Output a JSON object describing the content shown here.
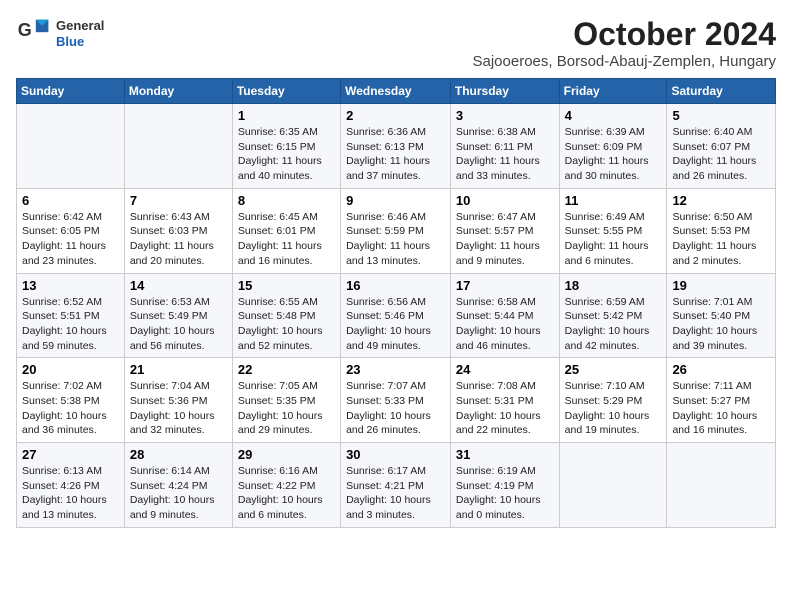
{
  "header": {
    "logo_line1": "General",
    "logo_line2": "Blue",
    "month": "October 2024",
    "location": "Sajooeroes, Borsod-Abauj-Zemplen, Hungary"
  },
  "weekdays": [
    "Sunday",
    "Monday",
    "Tuesday",
    "Wednesday",
    "Thursday",
    "Friday",
    "Saturday"
  ],
  "weeks": [
    [
      {
        "day": "",
        "detail": ""
      },
      {
        "day": "",
        "detail": ""
      },
      {
        "day": "1",
        "detail": "Sunrise: 6:35 AM\nSunset: 6:15 PM\nDaylight: 11 hours and 40 minutes."
      },
      {
        "day": "2",
        "detail": "Sunrise: 6:36 AM\nSunset: 6:13 PM\nDaylight: 11 hours and 37 minutes."
      },
      {
        "day": "3",
        "detail": "Sunrise: 6:38 AM\nSunset: 6:11 PM\nDaylight: 11 hours and 33 minutes."
      },
      {
        "day": "4",
        "detail": "Sunrise: 6:39 AM\nSunset: 6:09 PM\nDaylight: 11 hours and 30 minutes."
      },
      {
        "day": "5",
        "detail": "Sunrise: 6:40 AM\nSunset: 6:07 PM\nDaylight: 11 hours and 26 minutes."
      }
    ],
    [
      {
        "day": "6",
        "detail": "Sunrise: 6:42 AM\nSunset: 6:05 PM\nDaylight: 11 hours and 23 minutes."
      },
      {
        "day": "7",
        "detail": "Sunrise: 6:43 AM\nSunset: 6:03 PM\nDaylight: 11 hours and 20 minutes."
      },
      {
        "day": "8",
        "detail": "Sunrise: 6:45 AM\nSunset: 6:01 PM\nDaylight: 11 hours and 16 minutes."
      },
      {
        "day": "9",
        "detail": "Sunrise: 6:46 AM\nSunset: 5:59 PM\nDaylight: 11 hours and 13 minutes."
      },
      {
        "day": "10",
        "detail": "Sunrise: 6:47 AM\nSunset: 5:57 PM\nDaylight: 11 hours and 9 minutes."
      },
      {
        "day": "11",
        "detail": "Sunrise: 6:49 AM\nSunset: 5:55 PM\nDaylight: 11 hours and 6 minutes."
      },
      {
        "day": "12",
        "detail": "Sunrise: 6:50 AM\nSunset: 5:53 PM\nDaylight: 11 hours and 2 minutes."
      }
    ],
    [
      {
        "day": "13",
        "detail": "Sunrise: 6:52 AM\nSunset: 5:51 PM\nDaylight: 10 hours and 59 minutes."
      },
      {
        "day": "14",
        "detail": "Sunrise: 6:53 AM\nSunset: 5:49 PM\nDaylight: 10 hours and 56 minutes."
      },
      {
        "day": "15",
        "detail": "Sunrise: 6:55 AM\nSunset: 5:48 PM\nDaylight: 10 hours and 52 minutes."
      },
      {
        "day": "16",
        "detail": "Sunrise: 6:56 AM\nSunset: 5:46 PM\nDaylight: 10 hours and 49 minutes."
      },
      {
        "day": "17",
        "detail": "Sunrise: 6:58 AM\nSunset: 5:44 PM\nDaylight: 10 hours and 46 minutes."
      },
      {
        "day": "18",
        "detail": "Sunrise: 6:59 AM\nSunset: 5:42 PM\nDaylight: 10 hours and 42 minutes."
      },
      {
        "day": "19",
        "detail": "Sunrise: 7:01 AM\nSunset: 5:40 PM\nDaylight: 10 hours and 39 minutes."
      }
    ],
    [
      {
        "day": "20",
        "detail": "Sunrise: 7:02 AM\nSunset: 5:38 PM\nDaylight: 10 hours and 36 minutes."
      },
      {
        "day": "21",
        "detail": "Sunrise: 7:04 AM\nSunset: 5:36 PM\nDaylight: 10 hours and 32 minutes."
      },
      {
        "day": "22",
        "detail": "Sunrise: 7:05 AM\nSunset: 5:35 PM\nDaylight: 10 hours and 29 minutes."
      },
      {
        "day": "23",
        "detail": "Sunrise: 7:07 AM\nSunset: 5:33 PM\nDaylight: 10 hours and 26 minutes."
      },
      {
        "day": "24",
        "detail": "Sunrise: 7:08 AM\nSunset: 5:31 PM\nDaylight: 10 hours and 22 minutes."
      },
      {
        "day": "25",
        "detail": "Sunrise: 7:10 AM\nSunset: 5:29 PM\nDaylight: 10 hours and 19 minutes."
      },
      {
        "day": "26",
        "detail": "Sunrise: 7:11 AM\nSunset: 5:27 PM\nDaylight: 10 hours and 16 minutes."
      }
    ],
    [
      {
        "day": "27",
        "detail": "Sunrise: 6:13 AM\nSunset: 4:26 PM\nDaylight: 10 hours and 13 minutes."
      },
      {
        "day": "28",
        "detail": "Sunrise: 6:14 AM\nSunset: 4:24 PM\nDaylight: 10 hours and 9 minutes."
      },
      {
        "day": "29",
        "detail": "Sunrise: 6:16 AM\nSunset: 4:22 PM\nDaylight: 10 hours and 6 minutes."
      },
      {
        "day": "30",
        "detail": "Sunrise: 6:17 AM\nSunset: 4:21 PM\nDaylight: 10 hours and 3 minutes."
      },
      {
        "day": "31",
        "detail": "Sunrise: 6:19 AM\nSunset: 4:19 PM\nDaylight: 10 hours and 0 minutes."
      },
      {
        "day": "",
        "detail": ""
      },
      {
        "day": "",
        "detail": ""
      }
    ]
  ]
}
